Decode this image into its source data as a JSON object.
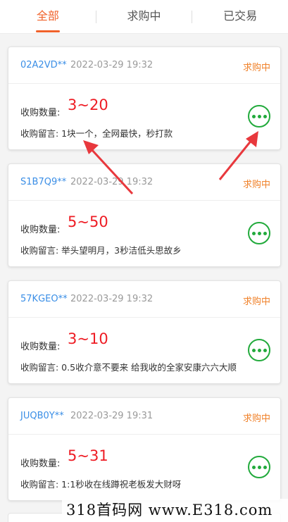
{
  "tabs": [
    {
      "label": "全部",
      "active": true
    },
    {
      "label": "求购中",
      "active": false
    },
    {
      "label": "已交易",
      "active": false
    }
  ],
  "orders": [
    {
      "uid": "02A2VD**",
      "time": "2022-03-29 19:32",
      "status": "求购中",
      "qty_label": "收购数量:",
      "qty": "3~20",
      "note": "收购留言: 1块一个，全网最快，秒打款"
    },
    {
      "uid": "S1B7Q9**",
      "time": "2022-03-29 19:32",
      "status": "求购中",
      "qty_label": "收购数量:",
      "qty": "5~50",
      "note": "收购留言: 举头望明月，3秒洁低头思故乡"
    },
    {
      "uid": "57KGEO**",
      "time": "2022-03-29 19:32",
      "status": "求购中",
      "qty_label": "收购数量:",
      "qty": "3~10",
      "note": "收购留言: 0.5收介意不要来 给我收的全家安康六六大顺"
    },
    {
      "uid": "JUQB0Y**",
      "time": "2022-03-29 19:31",
      "status": "求购中",
      "qty_label": "收购数量:",
      "qty": "5~31",
      "note": "收购留言: 1:1秒收在线蹲祝老板发大财呀"
    }
  ],
  "watermark": "318首码网 www.E318.com",
  "colors": {
    "accent": "#f0622b",
    "status": "#f0822b",
    "qty": "#ee1c24",
    "uid": "#3a8ee6",
    "more_icon": "#22aa3c",
    "arrow": "#e8383d"
  }
}
